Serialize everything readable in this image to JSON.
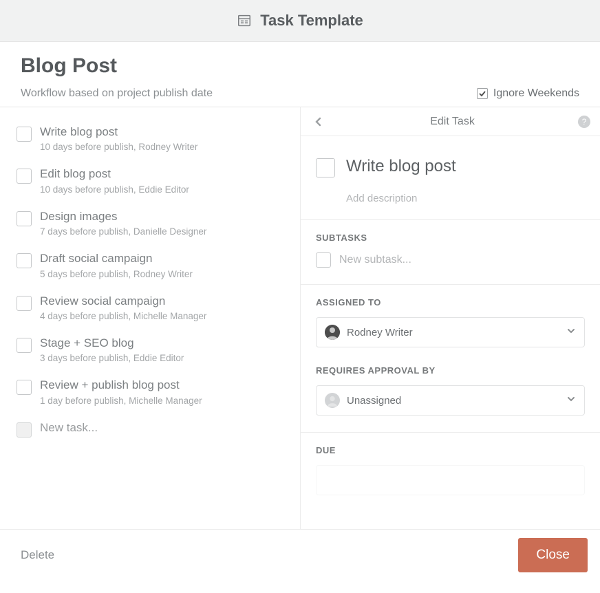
{
  "topbar": {
    "title": "Task Template"
  },
  "header": {
    "title": "Blog Post",
    "subtitle": "Workflow based on project publish date",
    "ignore_weekends_label": "Ignore Weekends",
    "ignore_weekends_checked": true
  },
  "left": {
    "tasks": [
      {
        "title": "Write blog post",
        "sub": "10 days before publish,   Rodney Writer"
      },
      {
        "title": "Edit blog post",
        "sub": "10 days before publish,   Eddie Editor"
      },
      {
        "title": "Design images",
        "sub": "7 days before publish,   Danielle Designer"
      },
      {
        "title": "Draft social campaign",
        "sub": "5 days before publish,   Rodney Writer"
      },
      {
        "title": "Review social campaign",
        "sub": "4 days before publish,   Michelle Manager"
      },
      {
        "title": "Stage + SEO blog",
        "sub": "3 days before publish,   Eddie Editor"
      },
      {
        "title": "Review + publish blog post",
        "sub": "1 day before publish,   Michelle Manager"
      }
    ],
    "new_task_placeholder": "New task..."
  },
  "right": {
    "header_label": "Edit Task",
    "task_title": "Write blog post",
    "add_description_placeholder": "Add description",
    "subtasks_heading": "SUBTASKS",
    "new_subtask_placeholder": "New subtask...",
    "assigned_heading": "ASSIGNED TO",
    "assigned_name": "Rodney Writer",
    "approval_heading": "REQUIRES APPROVAL BY",
    "approval_name": "Unassigned",
    "due_heading": "DUE"
  },
  "footer": {
    "delete_label": "Delete",
    "close_label": "Close"
  }
}
